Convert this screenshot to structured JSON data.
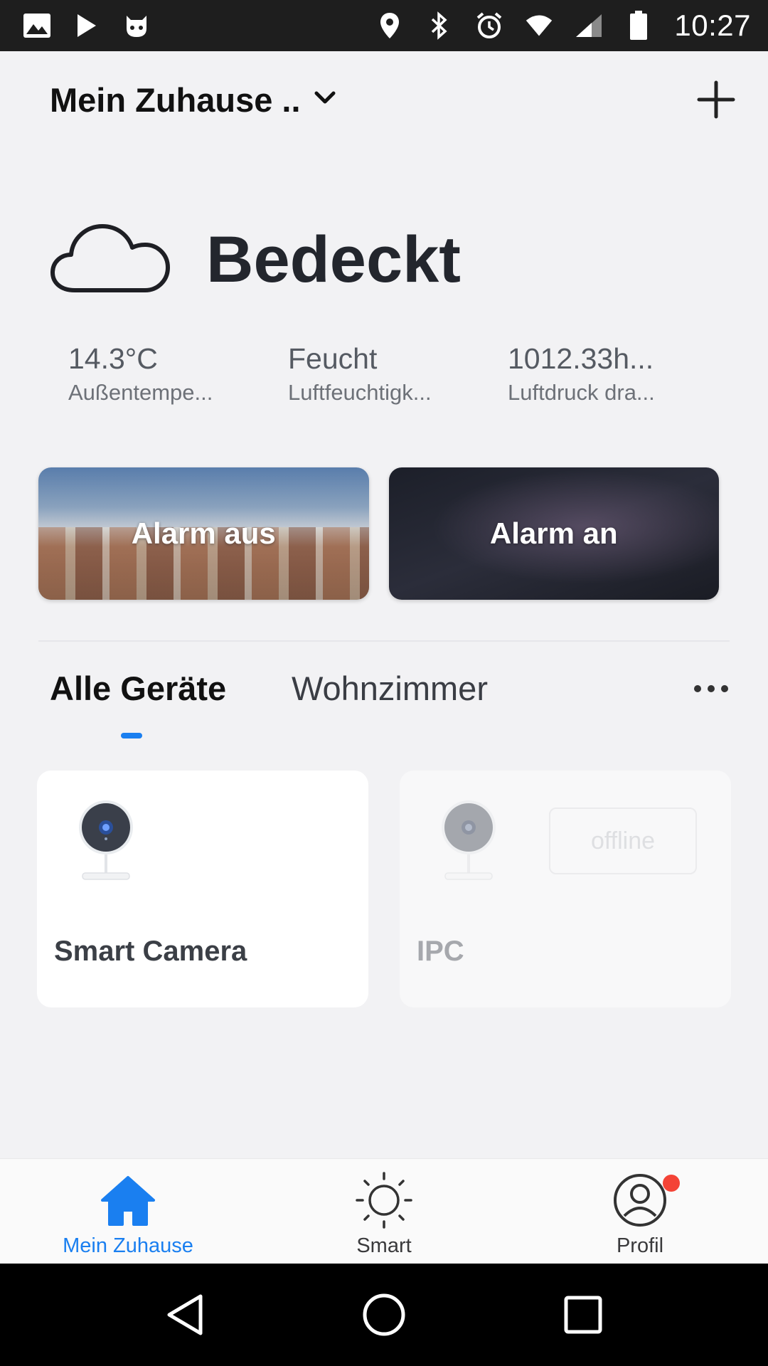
{
  "status_bar": {
    "time": "10:27",
    "left_icons": [
      "image-icon",
      "play-store-icon",
      "app-notification-icon"
    ],
    "right_icons": [
      "location-icon",
      "bluetooth-icon",
      "alarm-icon",
      "wifi-icon",
      "cellular-icon",
      "battery-icon"
    ]
  },
  "header": {
    "home_title": "Mein Zuhause ..",
    "dropdown_icon": "chevron-down-icon",
    "add_icon": "plus-icon"
  },
  "weather": {
    "icon": "cloud-icon",
    "condition": "Bedeckt",
    "stats": [
      {
        "value": "14.3°C",
        "label": "Außentempe..."
      },
      {
        "value": "Feucht",
        "label": "Luftfeuchtigk..."
      },
      {
        "value": "1012.33h...",
        "label": "Luftdruck dra..."
      }
    ]
  },
  "scenes": [
    {
      "label": "Alarm aus"
    },
    {
      "label": "Alarm an"
    }
  ],
  "tabs": {
    "items": [
      {
        "label": "Alle Geräte",
        "active": true
      },
      {
        "label": "Wohnzimmer",
        "active": false
      }
    ],
    "more_icon": "more-horizontal-icon"
  },
  "devices": [
    {
      "name": "Smart  Camera",
      "status": "online"
    },
    {
      "name": "IPC",
      "status": "offline",
      "badge": "offline"
    }
  ],
  "bottom_nav": {
    "items": [
      {
        "label": "Mein Zuhause",
        "icon": "home-icon",
        "active": true
      },
      {
        "label": "Smart",
        "icon": "sun-icon",
        "active": false
      },
      {
        "label": "Profil",
        "icon": "profile-icon",
        "active": false
      }
    ]
  },
  "colors": {
    "accent": "#1a7ff0",
    "notification": "#f44336",
    "background": "#f2f2f4"
  }
}
